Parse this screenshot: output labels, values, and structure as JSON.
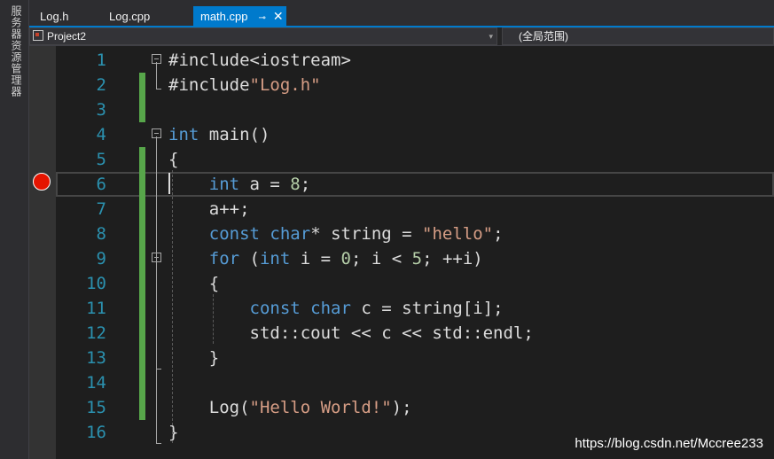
{
  "sidebar": {
    "label": "服务器资源管理器"
  },
  "tabs": [
    {
      "label": "Log.h"
    },
    {
      "label": "Log.cpp"
    },
    {
      "label": "math.cpp",
      "pin": "⊸",
      "close": "✕"
    }
  ],
  "nav": {
    "project": "Project2",
    "scope": "(全局范围)"
  },
  "editor": {
    "lines": [
      {
        "n": "1",
        "tokens": [
          {
            "t": "#include<iostream>",
            "c": ""
          }
        ]
      },
      {
        "n": "2",
        "tokens": [
          {
            "t": "#include",
            "c": ""
          },
          {
            "t": "\"Log.h\"",
            "c": "str"
          }
        ]
      },
      {
        "n": "3",
        "tokens": []
      },
      {
        "n": "4",
        "tokens": [
          {
            "t": "int",
            "c": "kw"
          },
          {
            "t": " main()",
            "c": ""
          }
        ]
      },
      {
        "n": "5",
        "tokens": [
          {
            "t": "{",
            "c": ""
          }
        ]
      },
      {
        "n": "6",
        "tokens": [
          {
            "t": "    ",
            "c": ""
          },
          {
            "t": "int",
            "c": "kw"
          },
          {
            "t": " a = ",
            "c": ""
          },
          {
            "t": "8",
            "c": "num"
          },
          {
            "t": ";",
            "c": ""
          }
        ]
      },
      {
        "n": "7",
        "tokens": [
          {
            "t": "    a++;",
            "c": ""
          }
        ]
      },
      {
        "n": "8",
        "tokens": [
          {
            "t": "    ",
            "c": ""
          },
          {
            "t": "const",
            "c": "kw"
          },
          {
            "t": " ",
            "c": ""
          },
          {
            "t": "char",
            "c": "kw"
          },
          {
            "t": "* string = ",
            "c": ""
          },
          {
            "t": "\"hello\"",
            "c": "str"
          },
          {
            "t": ";",
            "c": ""
          }
        ]
      },
      {
        "n": "9",
        "tokens": [
          {
            "t": "    ",
            "c": ""
          },
          {
            "t": "for",
            "c": "kw"
          },
          {
            "t": " (",
            "c": ""
          },
          {
            "t": "int",
            "c": "kw"
          },
          {
            "t": " i = ",
            "c": ""
          },
          {
            "t": "0",
            "c": "num"
          },
          {
            "t": "; i < ",
            "c": ""
          },
          {
            "t": "5",
            "c": "num"
          },
          {
            "t": "; ++i)",
            "c": ""
          }
        ]
      },
      {
        "n": "10",
        "tokens": [
          {
            "t": "    {",
            "c": ""
          }
        ]
      },
      {
        "n": "11",
        "tokens": [
          {
            "t": "        ",
            "c": ""
          },
          {
            "t": "const",
            "c": "kw"
          },
          {
            "t": " ",
            "c": ""
          },
          {
            "t": "char",
            "c": "kw"
          },
          {
            "t": " c = string[i];",
            "c": ""
          }
        ]
      },
      {
        "n": "12",
        "tokens": [
          {
            "t": "        std::cout << c << std::endl;",
            "c": ""
          }
        ]
      },
      {
        "n": "13",
        "tokens": [
          {
            "t": "    }",
            "c": ""
          }
        ]
      },
      {
        "n": "14",
        "tokens": []
      },
      {
        "n": "15",
        "tokens": [
          {
            "t": "    Log(",
            "c": ""
          },
          {
            "t": "\"Hello World!\"",
            "c": "str"
          },
          {
            "t": ");",
            "c": ""
          }
        ]
      },
      {
        "n": "16",
        "tokens": [
          {
            "t": "}",
            "c": ""
          }
        ]
      }
    ]
  },
  "watermark": "https://blog.csdn.net/Mccree233",
  "colors": {
    "keyword": "#569cd6",
    "string": "#d69d85",
    "number": "#b5cea8",
    "line_number": "#2b91af",
    "change_bar": "#57a64a",
    "active_tab": "#007acc",
    "breakpoint": "#e51400"
  }
}
